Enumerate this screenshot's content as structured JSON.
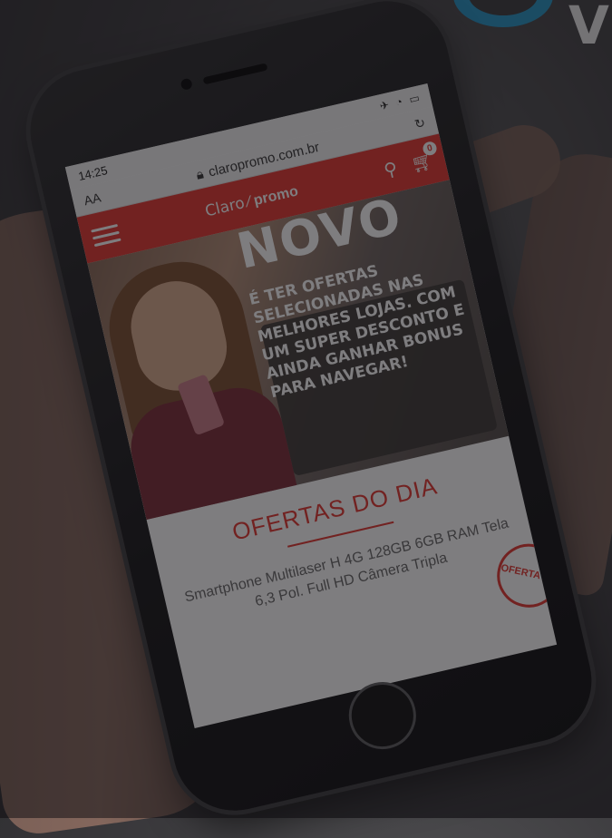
{
  "status_bar": {
    "time": "14:25"
  },
  "browser": {
    "text_size_label": "AA",
    "url": "claropromo.com.br",
    "reload_icon": "reload-icon"
  },
  "site_header": {
    "brand": "Claro",
    "promo": "promo",
    "cart_count": "0",
    "accent_color": "#e4352f"
  },
  "hero": {
    "title": "NOVO",
    "text": "É TER OFERTAS SELECIONADAS NAS MELHORES LOJAS. COM UM SUPER DESCONTO E AINDA GANHAR BONUS PARA NAVEGAR!"
  },
  "offers": {
    "title": "OFERTAS DO DIA",
    "product_name": "Smartphone Multilaser H 4G 128GB 6GB RAM Tela 6,3 Pol. Full HD Câmera Tripla",
    "stamp_text": "OFERTA DO"
  },
  "corner_brand": {
    "letter": "V"
  }
}
